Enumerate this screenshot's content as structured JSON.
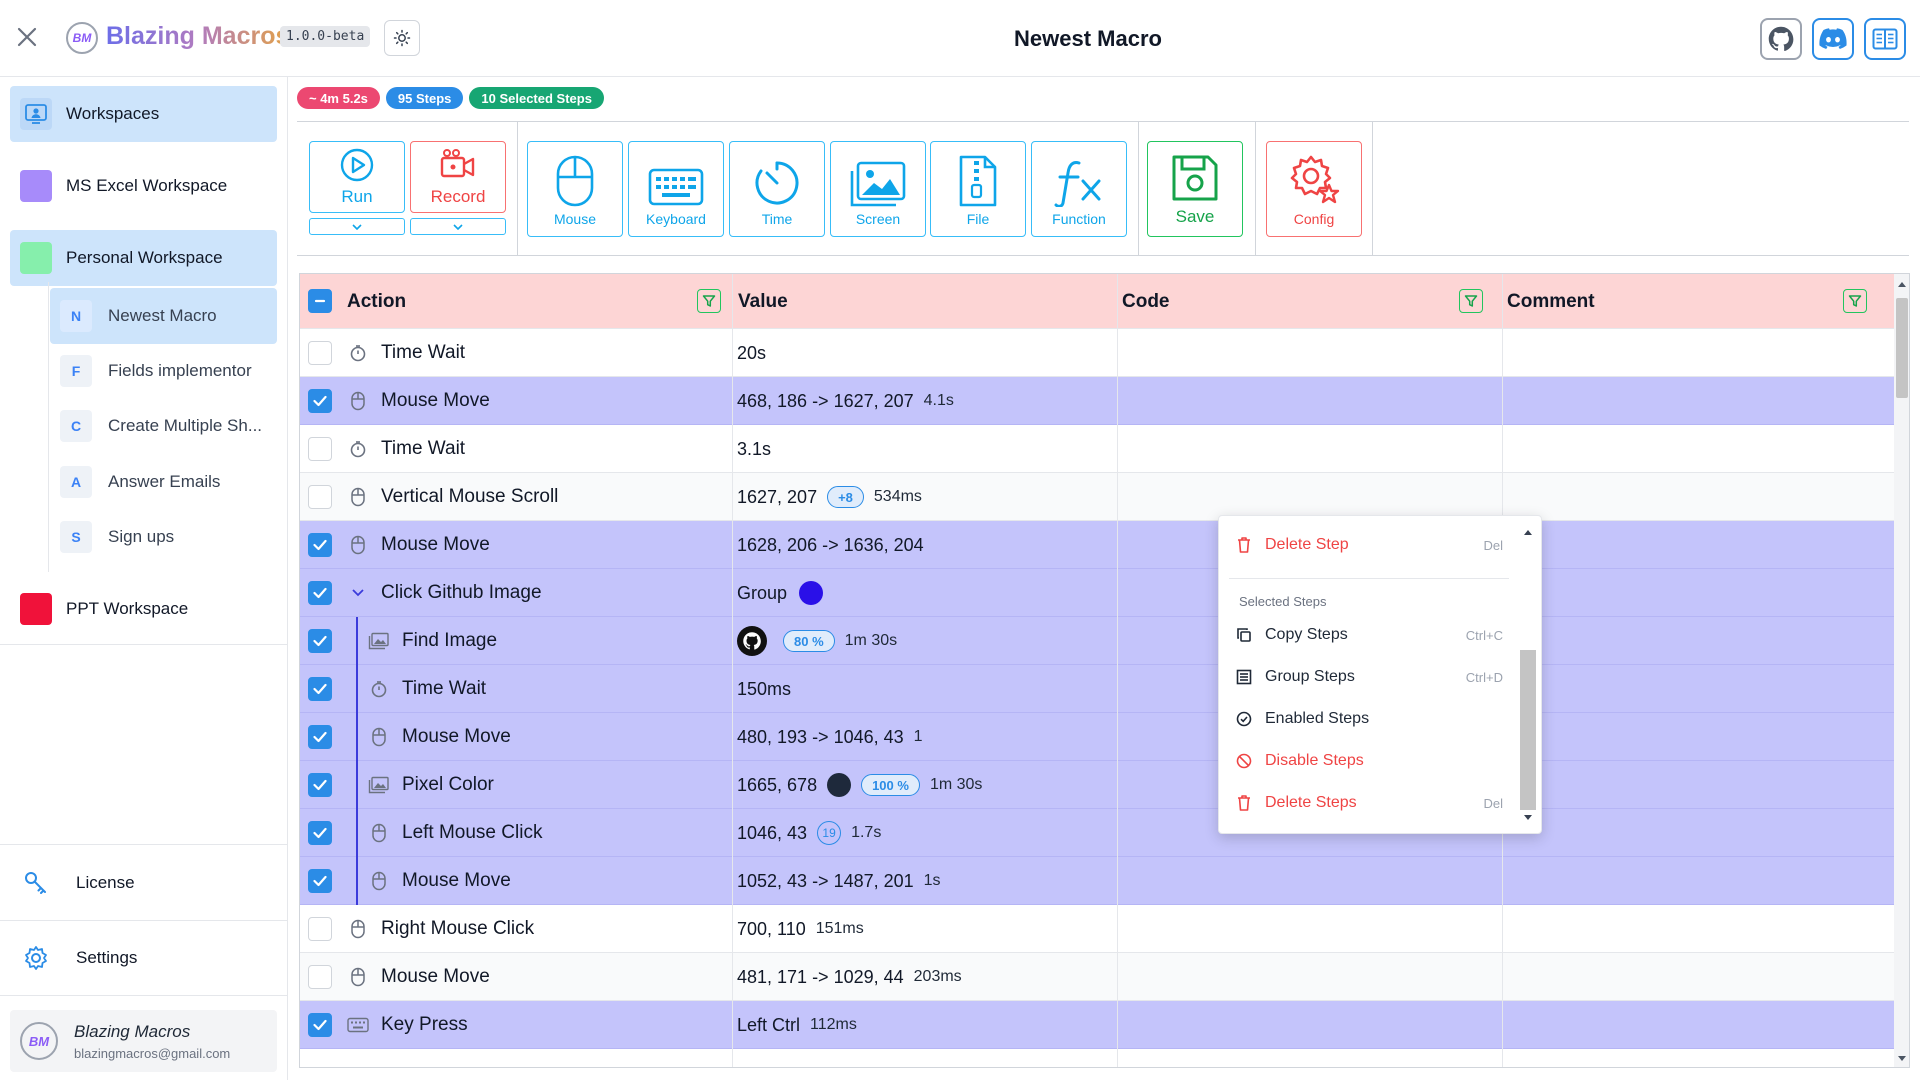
{
  "app": {
    "name": "Blazing Macros",
    "version": "1.0.0-beta",
    "page_title": "Newest Macro",
    "logo_text": "BM"
  },
  "header_icons": [
    "github-icon",
    "discord-icon",
    "docs-icon"
  ],
  "sidebar": {
    "workspaces_label": "Workspaces",
    "workspaces": [
      {
        "label": "MS Excel Workspace",
        "color": "#a78bfa"
      },
      {
        "label": "Personal Workspace",
        "color": "#86efac"
      },
      {
        "label": "PPT Workspace",
        "color": "#f0123a"
      }
    ],
    "macros": [
      {
        "letter": "N",
        "label": "Newest Macro"
      },
      {
        "letter": "F",
        "label": "Fields implementor"
      },
      {
        "letter": "C",
        "label": "Create Multiple Sh..."
      },
      {
        "letter": "A",
        "label": "Answer Emails"
      },
      {
        "letter": "S",
        "label": "Sign ups"
      }
    ],
    "license_label": "License",
    "settings_label": "Settings",
    "user": {
      "name": "Blazing Macros",
      "email": "blazingmacros@gmail.com"
    }
  },
  "stats": {
    "duration": "~ 4m 5.2s",
    "steps": "95 Steps",
    "selected": "10 Selected Steps",
    "colors": {
      "duration": "#ec4871",
      "steps": "#2b8ce6",
      "selected": "#17a673"
    }
  },
  "toolbar": {
    "run": "Run",
    "record": "Record",
    "mouse": "Mouse",
    "keyboard": "Keyboard",
    "time": "Time",
    "screen": "Screen",
    "file": "File",
    "function": "Function",
    "save": "Save",
    "config": "Config"
  },
  "table": {
    "headers": {
      "action": "Action",
      "value": "Value",
      "code": "Code",
      "comment": "Comment"
    },
    "rows": [
      {
        "checked": false,
        "action": "Time Wait",
        "icon": "timer-icon",
        "value": "20s"
      },
      {
        "checked": true,
        "action": "Mouse Move",
        "icon": "mouse-icon",
        "value": "468, 186 -> 1627, 207",
        "dur": "4.1s"
      },
      {
        "checked": false,
        "action": "Time Wait",
        "icon": "timer-icon",
        "value": "3.1s"
      },
      {
        "checked": false,
        "action": "Vertical Mouse Scroll",
        "icon": "mouse-icon",
        "value": "1627, 207",
        "chip": "+8",
        "dur": "534ms"
      },
      {
        "checked": true,
        "action": "Mouse Move",
        "icon": "mouse-icon",
        "value": "1628, 206 -> 1636, 204"
      },
      {
        "checked": true,
        "action": "Click Github Image",
        "icon": "chevron-down-icon",
        "value": "Group",
        "group": true
      },
      {
        "checked": true,
        "action": "Find Image",
        "icon": "image-icon",
        "child": true,
        "value": "",
        "chip": "80 %",
        "dur": "1m 30s",
        "thumb": true
      },
      {
        "checked": true,
        "action": "Time Wait",
        "icon": "timer-icon",
        "child": true,
        "value": "150ms"
      },
      {
        "checked": true,
        "action": "Mouse Move",
        "icon": "mouse-icon",
        "child": true,
        "value": "480, 193 -> 1046, 43",
        "dur": "1"
      },
      {
        "checked": true,
        "action": "Pixel Color",
        "icon": "image-icon",
        "child": true,
        "value": "1665, 678",
        "swatch": "#1e293b",
        "chip": "100 %",
        "dur": "1m 30s"
      },
      {
        "checked": true,
        "action": "Left Mouse Click",
        "icon": "mouse-icon",
        "child": true,
        "value": "1046, 43",
        "circle": "19",
        "dur": "1.7s"
      },
      {
        "checked": true,
        "action": "Mouse Move",
        "icon": "mouse-icon",
        "child": true,
        "value": "1052, 43 -> 1487, 201",
        "dur": "1s"
      },
      {
        "checked": false,
        "action": "Right Mouse Click",
        "icon": "mouse-icon",
        "value": "700, 110",
        "dur": "151ms"
      },
      {
        "checked": false,
        "action": "Mouse Move",
        "icon": "mouse-icon",
        "value": "481, 171 -> 1029, 44",
        "dur": "203ms"
      },
      {
        "checked": true,
        "action": "Key Press",
        "icon": "keyboard-icon",
        "value": "Left Ctrl",
        "dur": "112ms"
      }
    ]
  },
  "context_menu": {
    "delete_step": {
      "label": "Delete Step",
      "shortcut": "Del"
    },
    "section": "Selected Steps",
    "copy": {
      "label": "Copy Steps",
      "shortcut": "Ctrl+C"
    },
    "group": {
      "label": "Group Steps",
      "shortcut": "Ctrl+D"
    },
    "enable": {
      "label": "Enabled Steps"
    },
    "disable": {
      "label": "Disable Steps"
    },
    "delete_steps": {
      "label": "Delete Steps",
      "shortcut": "Del"
    }
  },
  "colors": {
    "accent": "#2b8ce6",
    "selected_row": "#c4c4fb",
    "header": "#fdd5d5",
    "danger": "#ef4444"
  }
}
